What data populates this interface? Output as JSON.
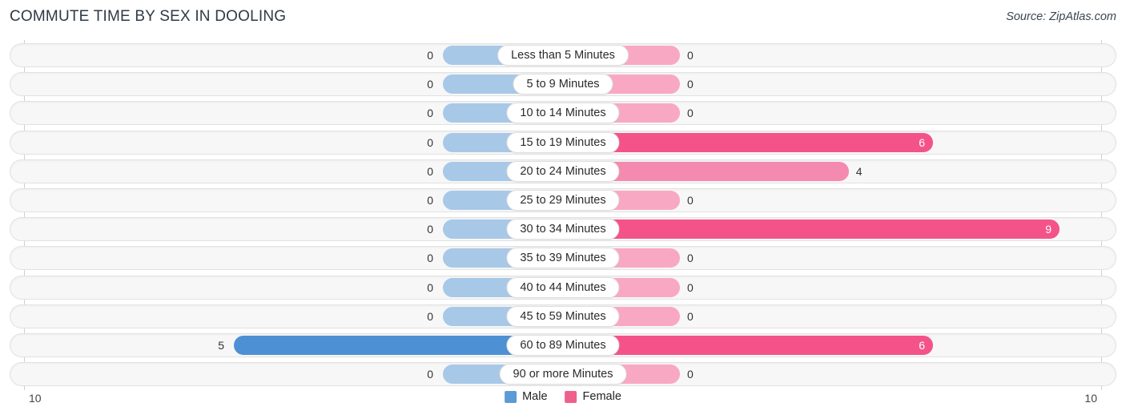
{
  "header": {
    "title": "COMMUTE TIME BY SEX IN DOOLING",
    "source": "Source: ZipAtlas.com"
  },
  "axis": {
    "left_label": "10",
    "right_label": "10"
  },
  "legend": {
    "items": [
      {
        "label": "Male",
        "color": "#5b9bd5"
      },
      {
        "label": "Female",
        "color": "#f0608c"
      }
    ]
  },
  "colors": {
    "male_zero": "#a8c8e8",
    "male_value": "#4d90d4",
    "female_zero": "#f9a8c4",
    "female_low": "#f58ab0",
    "female_high": "#f4538a",
    "track": "#f7f7f7",
    "track_border": "#e2e2e2",
    "gridline": "#cfcfcf"
  },
  "chart_data": {
    "type": "bar",
    "title": "COMMUTE TIME BY SEX IN DOOLING",
    "subtitle": "",
    "xlabel": "",
    "ylabel": "",
    "orientation": "horizontal-diverging",
    "xlim": [
      10,
      10
    ],
    "axis_left_max": 10,
    "axis_right_max": 10,
    "grid": true,
    "legend_position": "bottom-center",
    "categories": [
      "Less than 5 Minutes",
      "5 to 9 Minutes",
      "10 to 14 Minutes",
      "15 to 19 Minutes",
      "20 to 24 Minutes",
      "25 to 29 Minutes",
      "30 to 34 Minutes",
      "35 to 39 Minutes",
      "40 to 44 Minutes",
      "45 to 59 Minutes",
      "60 to 89 Minutes",
      "90 or more Minutes"
    ],
    "series": [
      {
        "name": "Male",
        "values": [
          0,
          0,
          0,
          0,
          0,
          0,
          0,
          0,
          0,
          0,
          5,
          0
        ]
      },
      {
        "name": "Female",
        "values": [
          0,
          0,
          0,
          6,
          4,
          0,
          9,
          0,
          0,
          0,
          6,
          0
        ]
      }
    ]
  },
  "rows": [
    {
      "category": "Less than 5 Minutes",
      "male": "0",
      "female": "0"
    },
    {
      "category": "5 to 9 Minutes",
      "male": "0",
      "female": "0"
    },
    {
      "category": "10 to 14 Minutes",
      "male": "0",
      "female": "0"
    },
    {
      "category": "15 to 19 Minutes",
      "male": "0",
      "female": "6"
    },
    {
      "category": "20 to 24 Minutes",
      "male": "0",
      "female": "4"
    },
    {
      "category": "25 to 29 Minutes",
      "male": "0",
      "female": "0"
    },
    {
      "category": "30 to 34 Minutes",
      "male": "0",
      "female": "9"
    },
    {
      "category": "35 to 39 Minutes",
      "male": "0",
      "female": "0"
    },
    {
      "category": "40 to 44 Minutes",
      "male": "0",
      "female": "0"
    },
    {
      "category": "45 to 59 Minutes",
      "male": "0",
      "female": "0"
    },
    {
      "category": "60 to 89 Minutes",
      "male": "5",
      "female": "6"
    },
    {
      "category": "90 or more Minutes",
      "male": "0",
      "female": "0"
    }
  ]
}
